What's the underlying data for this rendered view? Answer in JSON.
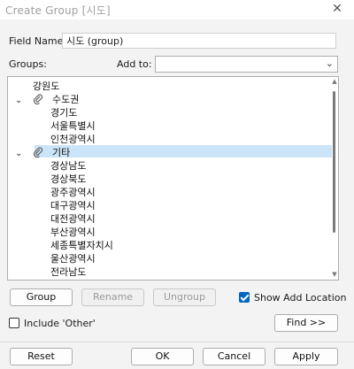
{
  "window": {
    "title": "Create Group [시도]",
    "close_glyph": "✕"
  },
  "field_name": {
    "label": "Field Name:",
    "value": "시도 (group)"
  },
  "groups_label": "Groups:",
  "add_to": {
    "label": "Add to:",
    "value": ""
  },
  "tree": {
    "items": [
      {
        "label": "강원도",
        "level": 0,
        "group": false
      },
      {
        "label": "수도권",
        "level": 0,
        "group": true,
        "expanded": true
      },
      {
        "label": "경기도",
        "level": 1,
        "group": false
      },
      {
        "label": "서울특별시",
        "level": 1,
        "group": false
      },
      {
        "label": "인천광역시",
        "level": 1,
        "group": false
      },
      {
        "label": "기타",
        "level": 0,
        "group": true,
        "expanded": true,
        "selected": true
      },
      {
        "label": "경상남도",
        "level": 1,
        "group": false
      },
      {
        "label": "경상북도",
        "level": 1,
        "group": false
      },
      {
        "label": "광주광역시",
        "level": 1,
        "group": false
      },
      {
        "label": "대구광역시",
        "level": 1,
        "group": false
      },
      {
        "label": "대전광역시",
        "level": 1,
        "group": false
      },
      {
        "label": "부산광역시",
        "level": 1,
        "group": false
      },
      {
        "label": "세종특별자치시",
        "level": 1,
        "group": false
      },
      {
        "label": "울산광역시",
        "level": 1,
        "group": false
      },
      {
        "label": "전라남도",
        "level": 1,
        "group": false
      }
    ]
  },
  "buttons": {
    "group": "Group",
    "rename": "Rename",
    "ungroup": "Ungroup",
    "show_add_location": "Show Add Location",
    "include_other": "Include 'Other'",
    "find": "Find >>",
    "reset": "Reset",
    "ok": "OK",
    "cancel": "Cancel",
    "apply": "Apply"
  },
  "state": {
    "show_add_location_checked": true,
    "include_other_checked": false
  },
  "colors": {
    "accent": "#0067c0",
    "selection": "#cce4f7"
  }
}
